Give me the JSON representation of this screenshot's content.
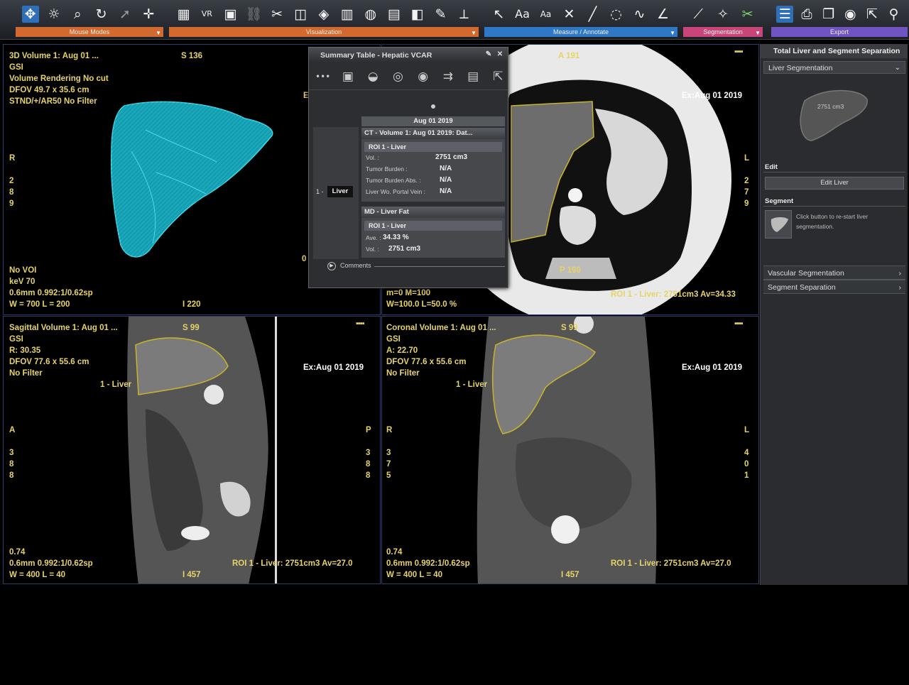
{
  "toolbar": {
    "groups": [
      {
        "label": "Mouse Modes",
        "icons": [
          "pan-zoom-icon",
          "brightness-icon",
          "magnify-icon",
          "rotate-icon",
          "pointer-icon",
          "crosshair-icon"
        ]
      },
      {
        "label": "Visualization",
        "icons": [
          "layout-icon",
          "vr-icon",
          "monitor-icon",
          "link-icon",
          "cut-icon",
          "cube-icon",
          "volume-icon",
          "slab-icon",
          "globe-icon",
          "film-icon",
          "lut-icon",
          "brush-icon",
          "ruler-icon"
        ]
      },
      {
        "label": "Measure / Annotate",
        "icons": [
          "arrow-icon",
          "text-icon",
          "text-small-icon",
          "cross-icon",
          "line-icon",
          "ellipse-icon",
          "curve-icon",
          "angle-icon"
        ]
      },
      {
        "label": "Segmentation",
        "icons": [
          "seg-scalpel-icon",
          "seg-magic-icon",
          "seg-scissors-icon"
        ]
      },
      {
        "label": "Export",
        "icons": [
          "list-icon",
          "print-icon",
          "copy-icon",
          "camera-icon",
          "export-icon",
          "person-icon"
        ]
      }
    ]
  },
  "vp_topleft": {
    "lines": [
      "3D Volume 1: Aug 01 ...",
      "GSI",
      "Volume Rendering No cut",
      "DFOV 49.7 x 35.6 cm",
      "STND/+/AR50 No Filter"
    ],
    "slice": "S 136",
    "orient_left": [
      "R",
      "",
      "2",
      "8",
      "9"
    ],
    "bottom_lines": [
      "No VOI",
      "keV 70",
      "0.6mm 0.992:1/0.62sp",
      "W = 700 L = 200"
    ],
    "bottom_center": "I 220",
    "edge_e": "E",
    "edge_zero": "0"
  },
  "vp_topright": {
    "top_center": "A 191",
    "exam": "Ex:Aug 01 2019",
    "orient_right": [
      "L",
      "",
      "2",
      "7",
      "9"
    ],
    "bottom_center": "P 190",
    "bottom_lines": [
      "m=0 M=100",
      "W=100.0 L=50.0 %"
    ],
    "roi": "ROI 1 - Liver: 2751cm3 Av=34.33"
  },
  "vp_bottomleft": {
    "lines": [
      "Sagittal Volume 1: Aug 01 ...",
      "GSI",
      "R: 30.35",
      "DFOV 77.6 x 55.6 cm",
      "No Filter"
    ],
    "slice": "S 99",
    "exam": "Ex:Aug 01 2019",
    "liver_label": "1 - Liver",
    "orient_left": [
      "A",
      "",
      "3",
      "8",
      "8"
    ],
    "orient_right": [
      "P",
      "",
      "3",
      "8",
      "8"
    ],
    "bottom_lines": [
      "0.74",
      "0.6mm 0.992:1/0.62sp",
      "W = 400 L = 40"
    ],
    "roi": "ROI 1 - Liver: 2751cm3 Av=27.0",
    "bottom_center": "I 457"
  },
  "vp_bottomright": {
    "lines": [
      "Coronal Volume 1: Aug 01 ...",
      "GSI",
      "A: 22.70",
      "DFOV 77.6 x 55.6 cm",
      "No Filter"
    ],
    "slice": "S 99",
    "exam": "Ex:Aug 01 2019",
    "liver_label": "1 - Liver",
    "orient_left": [
      "R",
      "",
      "3",
      "7",
      "5"
    ],
    "orient_right": [
      "L",
      "",
      "4",
      "0",
      "1"
    ],
    "bottom_lines": [
      "0.74",
      "0.6mm 0.992:1/0.62sp",
      "W = 400 L = 40"
    ],
    "roi": "ROI 1 - Liver: 2751cm3 Av=27.0",
    "bottom_center": "I 457"
  },
  "summary": {
    "title": "Summary Table - Hepatic VCAR",
    "date": "Aug 01 2019",
    "row_label_num": "1 -",
    "row_label": "Liver",
    "section1": {
      "header": "CT - Volume 1: Aug 01 2019: Dat...",
      "roi": "ROI 1 - Liver",
      "rows": [
        {
          "label": "Vol. :",
          "value": "2751 cm3"
        },
        {
          "label": "Tumor Burden :",
          "value": "N/A"
        },
        {
          "label": "Tumor Burden Abs. :",
          "value": "N/A"
        },
        {
          "label": "Liver Wo. Portal Vein :",
          "value": "N/A"
        }
      ]
    },
    "section2": {
      "header": "MD - Liver Fat",
      "roi": "ROI 1 - Liver",
      "rows": [
        {
          "label": "Ave. :",
          "value": "34.33  %"
        },
        {
          "label": "Vol. :",
          "value": "2751 cm3"
        }
      ]
    },
    "comments": "Comments"
  },
  "rpanel": {
    "title": "Total Liver and Segment Separation",
    "dropdown": "Liver Segmentation",
    "thumb_volume": "2751 cm3",
    "edit_label": "Edit",
    "edit_button": "Edit Liver",
    "segment_label": "Segment",
    "segment_hint": "Click button to re-start liver segmentation.",
    "links": [
      "Vascular Segmentation",
      "Segment Separation"
    ]
  },
  "colors": {
    "overlay": "#e6d36a",
    "liver_3d": "#1bb7c9",
    "contour": "#c9b52a"
  }
}
